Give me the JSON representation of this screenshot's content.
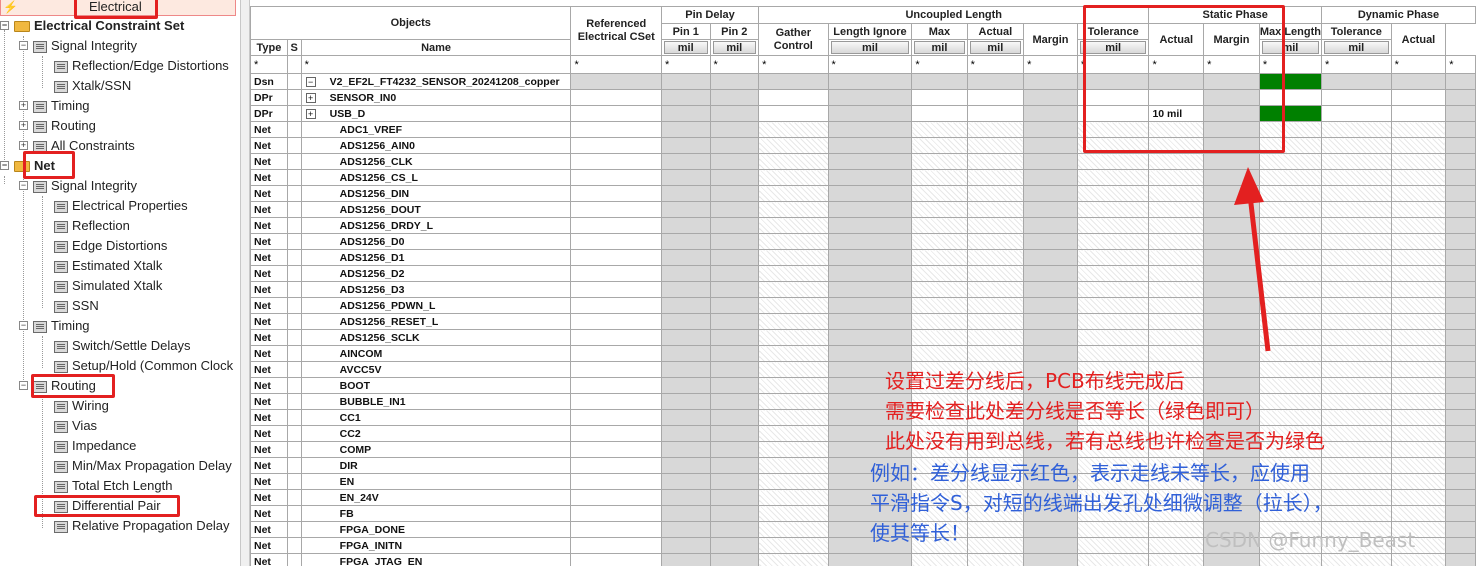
{
  "tree": {
    "electrical_tab": "Electrical",
    "electrical_constraint_set": "Electrical Constraint Set",
    "ecs_items": [
      "Signal Integrity",
      "Reflection/Edge Distortions",
      "Xtalk/SSN",
      "Timing",
      "Routing",
      "All Constraints"
    ],
    "net": "Net",
    "net_si": "Signal Integrity",
    "net_si_items": [
      "Electrical Properties",
      "Reflection",
      "Edge Distortions",
      "Estimated Xtalk",
      "Simulated Xtalk",
      "SSN"
    ],
    "net_timing": "Timing",
    "net_timing_items": [
      "Switch/Settle Delays",
      "Setup/Hold (Common Clock"
    ],
    "net_routing": "Routing",
    "net_routing_items": [
      "Wiring",
      "Vias",
      "Impedance",
      "Min/Max Propagation Delay",
      "Total Etch Length",
      "Differential Pair",
      "Relative Propagation Delay"
    ]
  },
  "grid": {
    "h_objects": "Objects",
    "h_type": "Type",
    "h_s": "S",
    "h_name": "Name",
    "h_ref": "Referenced Electrical CSet",
    "h_pin_delay": "Pin Delay",
    "h_pin1": "Pin 1",
    "h_pin2": "Pin 2",
    "h_uncoupled": "Uncoupled Length",
    "h_gather": "Gather Control",
    "h_len_ignore": "Length Ignore",
    "h_max": "Max",
    "h_actual": "Actual",
    "h_margin": "Margin",
    "h_static": "Static Phase",
    "h_tolerance": "Tolerance",
    "h_dynamic": "Dynamic Phase",
    "h_max_length": "Max Length",
    "unit": "mil",
    "star": "*",
    "rows": [
      {
        "type": "Dsn",
        "name": "V2_EF2L_FT4232_SENSOR_20241208_copper"
      },
      {
        "type": "DPr",
        "name": "SENSOR_IN0"
      },
      {
        "type": "DPr",
        "name": "USB_D",
        "tol": "10 mil"
      },
      {
        "type": "Net",
        "name": "ADC1_VREF"
      },
      {
        "type": "Net",
        "name": "ADS1256_AIN0"
      },
      {
        "type": "Net",
        "name": "ADS1256_CLK"
      },
      {
        "type": "Net",
        "name": "ADS1256_CS_L"
      },
      {
        "type": "Net",
        "name": "ADS1256_DIN"
      },
      {
        "type": "Net",
        "name": "ADS1256_DOUT"
      },
      {
        "type": "Net",
        "name": "ADS1256_DRDY_L"
      },
      {
        "type": "Net",
        "name": "ADS1256_D0"
      },
      {
        "type": "Net",
        "name": "ADS1256_D1"
      },
      {
        "type": "Net",
        "name": "ADS1256_D2"
      },
      {
        "type": "Net",
        "name": "ADS1256_D3"
      },
      {
        "type": "Net",
        "name": "ADS1256_PDWN_L"
      },
      {
        "type": "Net",
        "name": "ADS1256_RESET_L"
      },
      {
        "type": "Net",
        "name": "ADS1256_SCLK"
      },
      {
        "type": "Net",
        "name": "AINCOM"
      },
      {
        "type": "Net",
        "name": "AVCC5V"
      },
      {
        "type": "Net",
        "name": "BOOT"
      },
      {
        "type": "Net",
        "name": "BUBBLE_IN1"
      },
      {
        "type": "Net",
        "name": "CC1"
      },
      {
        "type": "Net",
        "name": "CC2"
      },
      {
        "type": "Net",
        "name": "COMP"
      },
      {
        "type": "Net",
        "name": "DIR"
      },
      {
        "type": "Net",
        "name": "EN"
      },
      {
        "type": "Net",
        "name": "EN_24V"
      },
      {
        "type": "Net",
        "name": "FB"
      },
      {
        "type": "Net",
        "name": "FPGA_DONE"
      },
      {
        "type": "Net",
        "name": "FPGA_INITN"
      },
      {
        "type": "Net",
        "name": "FPGA_JTAG_EN"
      }
    ]
  },
  "annotations": {
    "red_lines": [
      "设置过差分线后，PCB布线完成后",
      "需要检查此处差分线是否等长（绿色即可）",
      "此处没有用到总线，若有总线也许检查是否为绿色"
    ],
    "blue_lines": [
      "例如：差分线显示红色，表示走线未等长，应使用",
      "平滑指令S，对短的线端出发孔处细微调整（拉长），",
      "使其等长！"
    ]
  },
  "watermark": "CSDN @Funny_Beast",
  "colors": {
    "annotation_red": "#e32020",
    "annotation_blue": "#3060d8",
    "status_green": "#008000",
    "pin_yellow": "#ffff00"
  }
}
